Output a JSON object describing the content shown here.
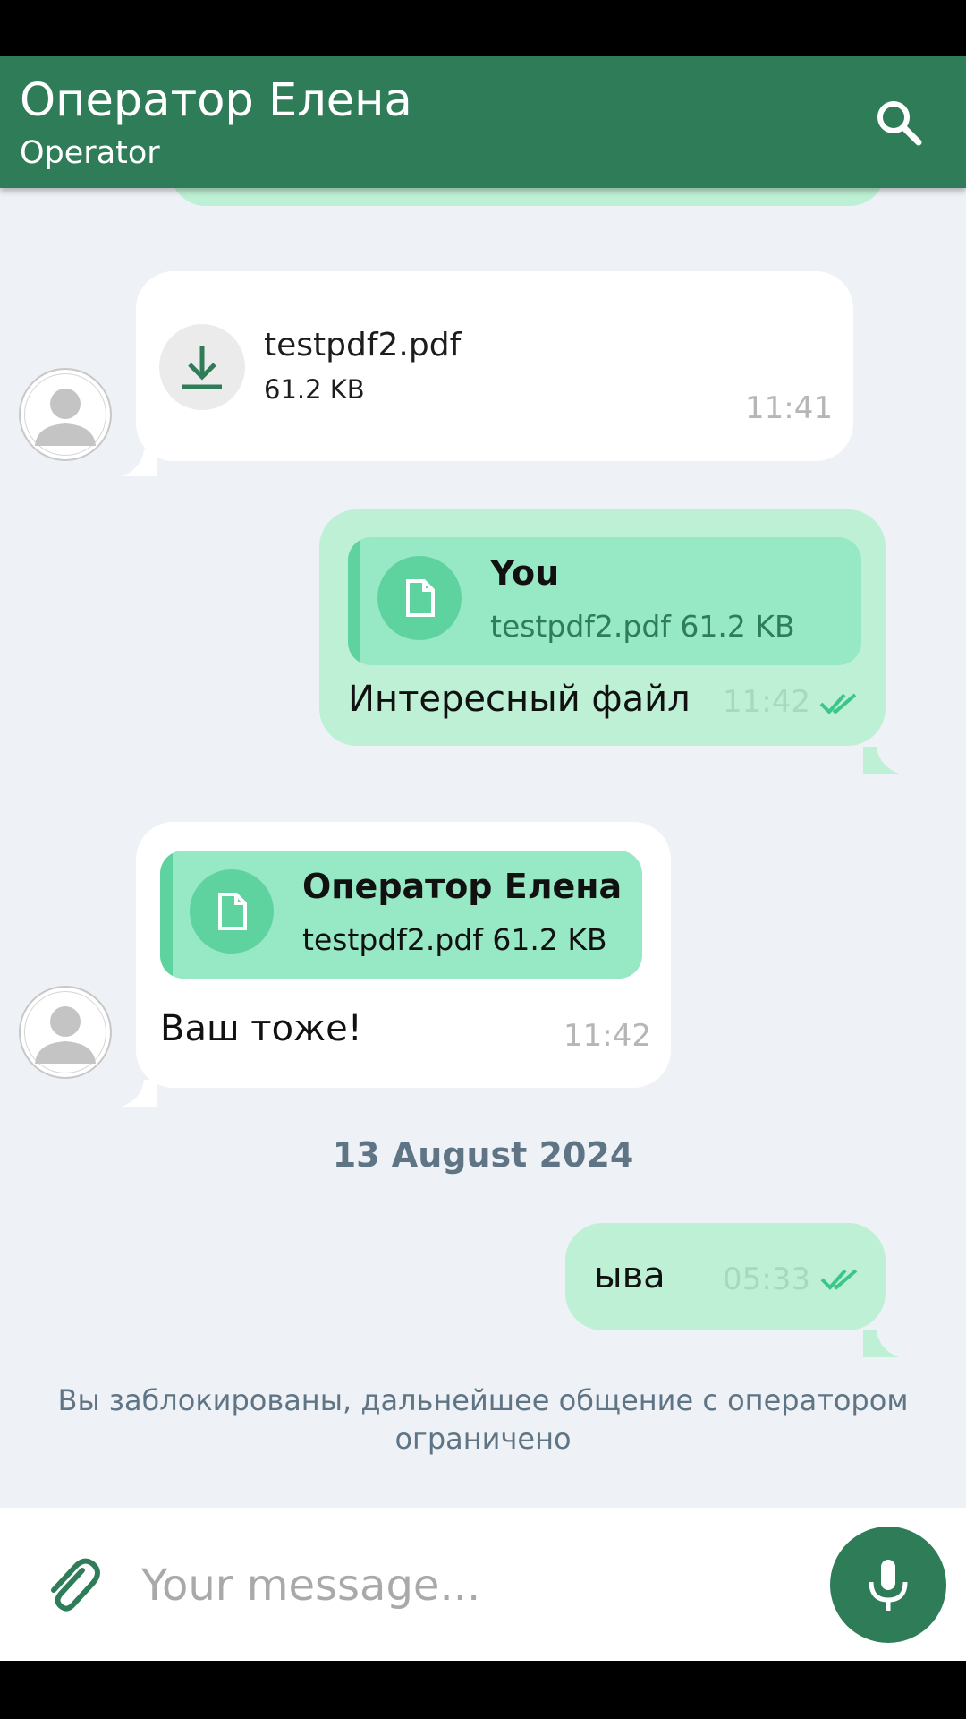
{
  "header": {
    "title": "Оператор Елена",
    "subtitle": "Operator",
    "search_icon": "search-icon"
  },
  "colors": {
    "primary": "#2f7d58",
    "chat_background": "#eef1f5",
    "incoming_bubble": "#ffffff",
    "outgoing_bubble": "#bdf0d5",
    "reply_background": "#97e8c4",
    "reply_accent": "#5fd39f"
  },
  "messages": [
    {
      "direction": "in",
      "type": "file",
      "file_name": "testpdf2.pdf",
      "file_size": "61.2 KB",
      "time": "11:41",
      "icon": "download-icon"
    },
    {
      "direction": "out",
      "type": "reply",
      "reply_author": "You",
      "reply_file": "testpdf2.pdf 61.2 KB",
      "text": "Интересный файл",
      "time": "11:42",
      "status": "read",
      "icon": "document-icon"
    },
    {
      "direction": "in",
      "type": "reply",
      "reply_author": "Оператор Елена",
      "reply_file": "testpdf2.pdf 61.2 KB",
      "text": "Ваш тоже!",
      "time": "11:42",
      "icon": "document-icon"
    },
    {
      "direction": "out",
      "type": "text",
      "text": "ыва",
      "time": "05:33",
      "status": "read"
    }
  ],
  "date_separator": "13 August 2024",
  "blocked_notice": "Вы заблокированы, дальнейшее общение с оператором ограничено",
  "composer": {
    "placeholder": "Your message...",
    "value": "",
    "attach_icon": "paperclip-icon",
    "mic_icon": "microphone-icon"
  }
}
